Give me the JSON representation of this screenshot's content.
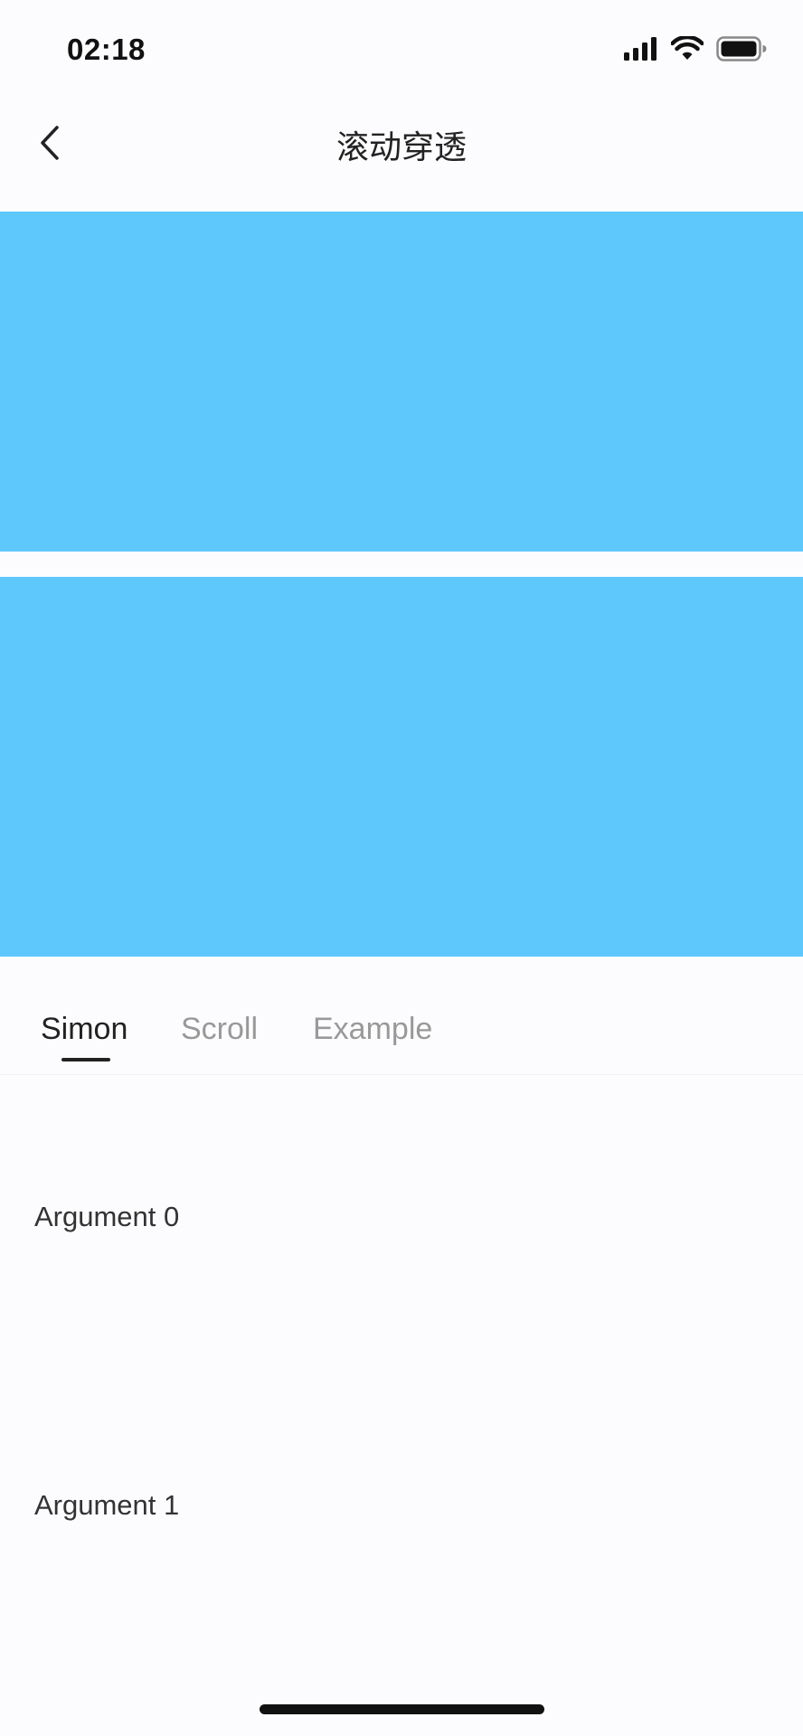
{
  "status_bar": {
    "time": "02:18",
    "icons": [
      "signal-icon",
      "wifi-icon",
      "battery-icon"
    ]
  },
  "nav": {
    "title": "滚动穿透",
    "back_icon": "chevron-left-icon"
  },
  "colors": {
    "banner": "#5ec8fc",
    "background": "#fcfcfe",
    "active_tab": "#222222",
    "inactive_tab": "#999999"
  },
  "tabs": [
    {
      "label": "Simon",
      "active": true
    },
    {
      "label": "Scroll",
      "active": false
    },
    {
      "label": "Example",
      "active": false
    }
  ],
  "list": [
    {
      "label": "Argument 0"
    },
    {
      "label": "Argument 1"
    }
  ]
}
